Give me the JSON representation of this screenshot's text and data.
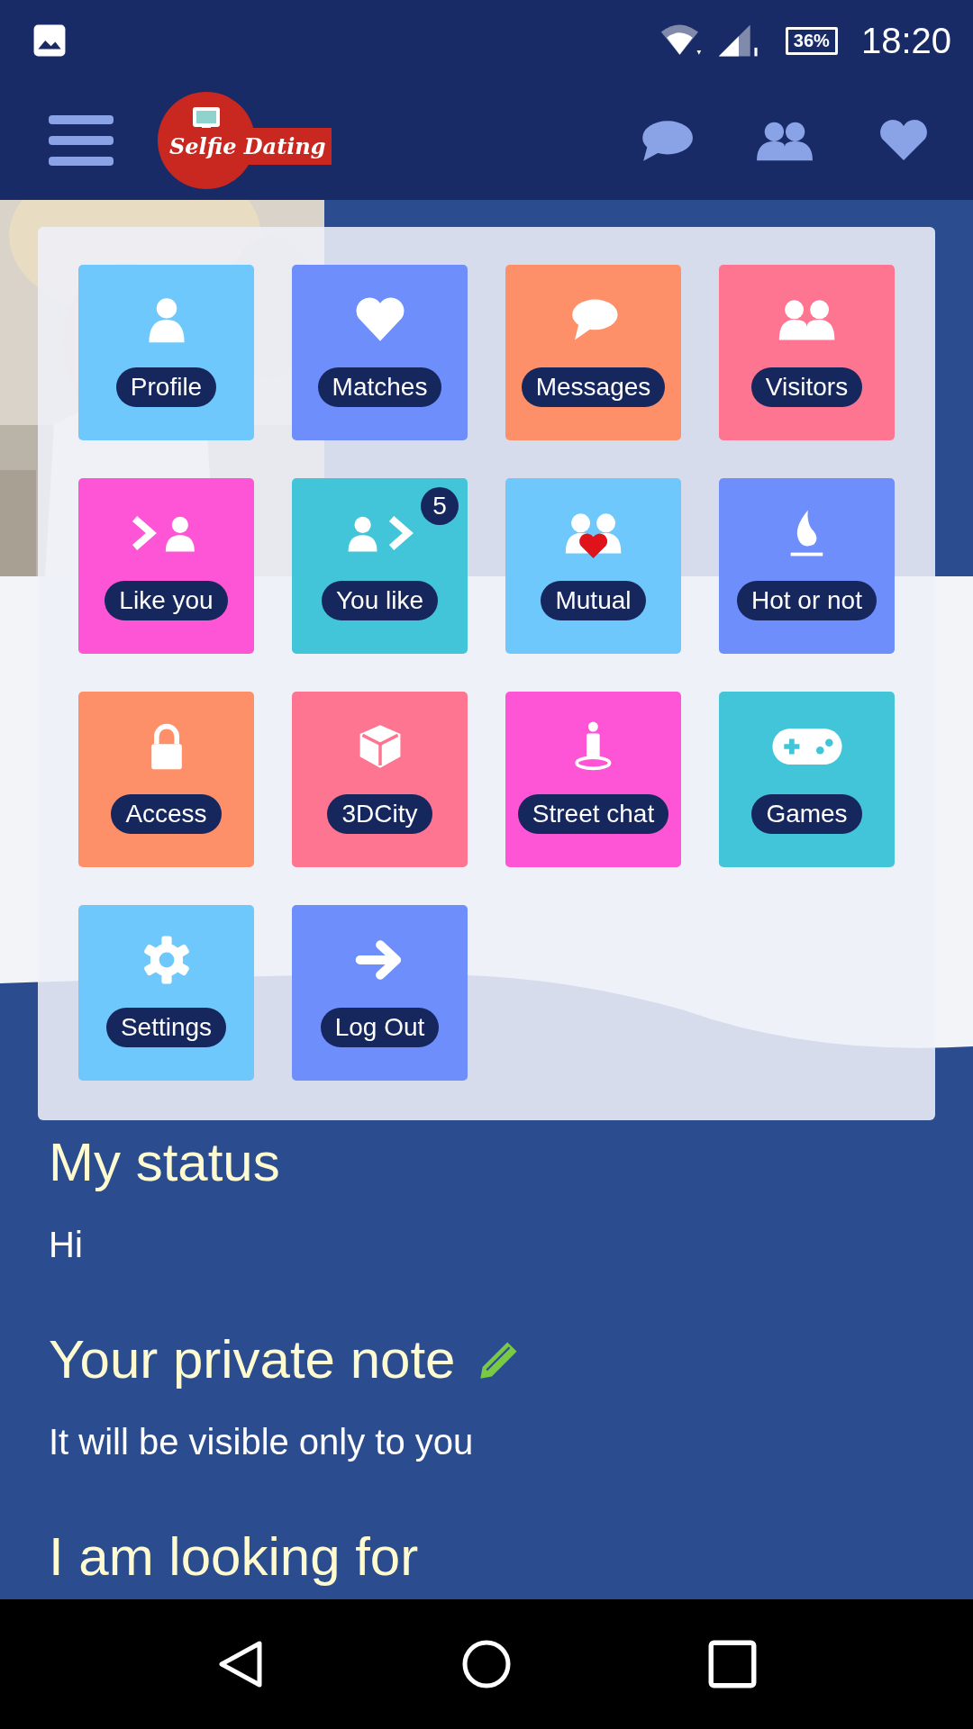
{
  "status_bar": {
    "battery": "36%",
    "time": "18:20"
  },
  "app_bar": {
    "logo": "Selfie Dating"
  },
  "menu": {
    "tiles": [
      {
        "kind": "profile",
        "label": "Profile",
        "color": "#6ec8fb"
      },
      {
        "kind": "matches",
        "label": "Matches",
        "color": "#6d8efb"
      },
      {
        "kind": "messages",
        "label": "Messages",
        "color": "#fd9068"
      },
      {
        "kind": "visitors",
        "label": "Visitors",
        "color": "#fd7590"
      },
      {
        "kind": "like_you",
        "label": "Like you",
        "color": "#fd55d5"
      },
      {
        "kind": "you_like",
        "label": "You like",
        "color": "#42c5d9",
        "badge": "5"
      },
      {
        "kind": "mutual",
        "label": "Mutual",
        "color": "#6ec8fb"
      },
      {
        "kind": "hot",
        "label": "Hot or not",
        "color": "#6d8efb"
      },
      {
        "kind": "access",
        "label": "Access",
        "color": "#fd9068"
      },
      {
        "kind": "city",
        "label": "3DCity",
        "color": "#fd7590"
      },
      {
        "kind": "street",
        "label": "Street chat",
        "color": "#fd55d5"
      },
      {
        "kind": "games",
        "label": "Games",
        "color": "#42c5d9"
      },
      {
        "kind": "settings",
        "label": "Settings",
        "color": "#6ec8fb"
      },
      {
        "kind": "logout",
        "label": "Log Out",
        "color": "#6d8efb"
      }
    ]
  },
  "sections": [
    {
      "heading": "My status",
      "text": "Hi"
    },
    {
      "heading": "Your private note",
      "editable": true,
      "text": "It will be visible only to you"
    },
    {
      "heading": "I am looking for"
    }
  ]
}
